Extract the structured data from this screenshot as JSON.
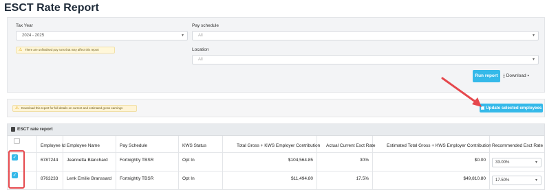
{
  "page": {
    "title": "ESCT Rate Report"
  },
  "filters": {
    "tax_year_label": "Tax Year",
    "tax_year_value": "2024 - 2025",
    "pay_schedule_label": "Pay schedule",
    "pay_schedule_value": "All",
    "location_label": "Location",
    "location_value": "All",
    "warning": "There are unfinalised pay runs that may affect this report"
  },
  "actions": {
    "run_report": "Run report",
    "download": "Download",
    "update_selected": "Update selected employees"
  },
  "info_note": "Download this report for full details on current and estimated gross earnings",
  "report": {
    "title": "ESCT rate report",
    "columns": [
      "Employee Id",
      "Employee Name",
      "Pay Schedule",
      "KWS Status",
      "Total Gross + KWS Employer Contribution",
      "Actual Current Esct Rate",
      "Estimated Total Gross + KWS Employer Contribution",
      "Recommended Esct Rate"
    ],
    "rows": [
      {
        "id": "6787244",
        "name": "Jeannetta Blanchard",
        "schedule": "Fortnightly TBSR",
        "kws": "Opt In",
        "total_gross": "$104,564.85",
        "current_rate": "30%",
        "estimated_gross": "$0.00",
        "recommended_rate": "33.00%",
        "selected": true
      },
      {
        "id": "8763233",
        "name": "Lenk Emilie Branssard",
        "schedule": "Fortnightly TBSR",
        "kws": "Opt In",
        "total_gross": "$11,494.80",
        "current_rate": "17.5%",
        "estimated_gross": "$49,810.80",
        "recommended_rate": "17.50%",
        "selected": true
      }
    ]
  },
  "colors": {
    "accent": "#35b9e9",
    "annotation": "#e5484d",
    "warning_bg": "#fff7d9"
  },
  "icons": [
    "warning-icon",
    "chevron-down-icon",
    "download-icon",
    "document-icon",
    "update-icon",
    "check-icon"
  ]
}
